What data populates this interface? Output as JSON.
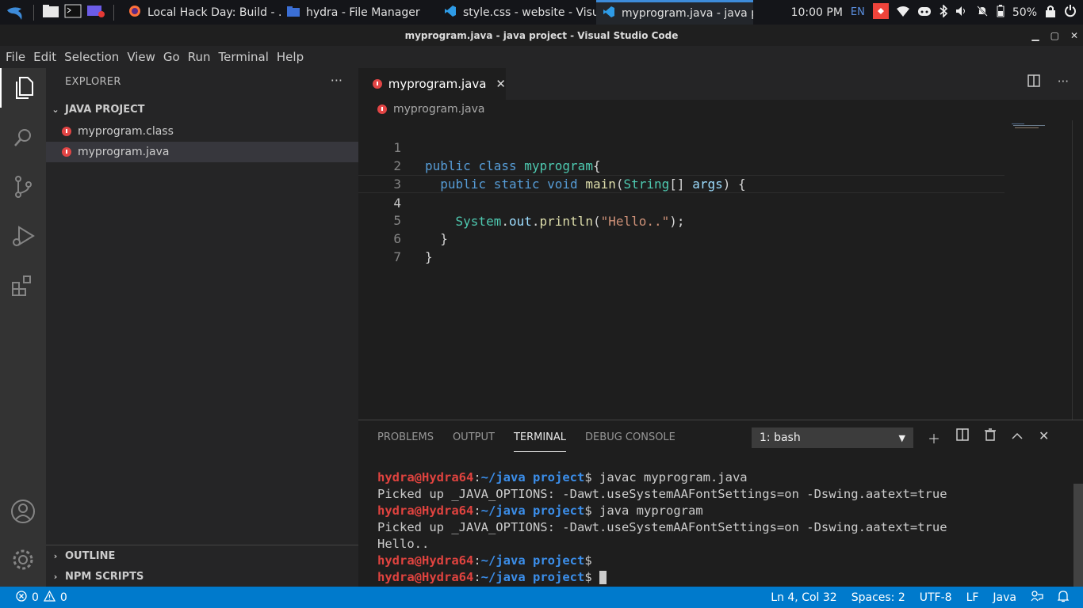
{
  "taskbar": {
    "tasks": [
      {
        "label": "Local Hack Day: Build - ...",
        "icon": "firefox-icon"
      },
      {
        "label": "hydra - File Manager",
        "icon": "file-manager-icon"
      },
      {
        "label": "style.css - website - Visu...",
        "icon": "vscode-icon"
      },
      {
        "label": "myprogram.java - java p...",
        "icon": "vscode-icon"
      }
    ],
    "clock": "10:00 PM",
    "lang": "EN",
    "battery": "50%"
  },
  "window": {
    "title": "myprogram.java - java project - Visual Studio Code"
  },
  "menu": [
    "File",
    "Edit",
    "Selection",
    "View",
    "Go",
    "Run",
    "Terminal",
    "Help"
  ],
  "sidebar": {
    "title": "EXPLORER",
    "project": "JAVA PROJECT",
    "files": [
      "myprogram.class",
      "myprogram.java"
    ],
    "sections": [
      "OUTLINE",
      "NPM SCRIPTS"
    ]
  },
  "editor": {
    "tab": "myprogram.java",
    "breadcrumb": "myprogram.java",
    "line_numbers": [
      "1",
      "2",
      "3",
      "4",
      "5",
      "6",
      "7"
    ],
    "tokens": {
      "public": "public",
      "class": "class",
      "static": "static",
      "void": "void",
      "myprogram": "myprogram",
      "main": "main",
      "String": "String",
      "args": "args",
      "System": "System",
      "out": "out",
      "println": "println",
      "hello": "\"Hello..\""
    }
  },
  "panel": {
    "tabs": [
      "PROBLEMS",
      "OUTPUT",
      "TERMINAL",
      "DEBUG CONSOLE"
    ],
    "terminal_select": "1: bash",
    "prompt_user": "hydra@Hydra64",
    "prompt_path": "~/java project",
    "terminal_lines": [
      {
        "kind": "cmd",
        "cmd": "javac myprogram.java"
      },
      {
        "kind": "out",
        "text": "Picked up _JAVA_OPTIONS: -Dawt.useSystemAAFontSettings=on -Dswing.aatext=true"
      },
      {
        "kind": "cmd",
        "cmd": "java myprogram"
      },
      {
        "kind": "out",
        "text": "Picked up _JAVA_OPTIONS: -Dawt.useSystemAAFontSettings=on -Dswing.aatext=true"
      },
      {
        "kind": "out",
        "text": "Hello.."
      },
      {
        "kind": "cmd",
        "cmd": ""
      }
    ]
  },
  "statusbar": {
    "errors": "0",
    "warnings": "0",
    "position": "Ln 4, Col 32",
    "spaces": "Spaces: 2",
    "encoding": "UTF-8",
    "eol": "LF",
    "language": "Java"
  },
  "colors": {
    "accent": "#007acc",
    "prompt_user": "#e0433f",
    "prompt_path": "#3b8eea",
    "java_icon": "#e24545"
  }
}
